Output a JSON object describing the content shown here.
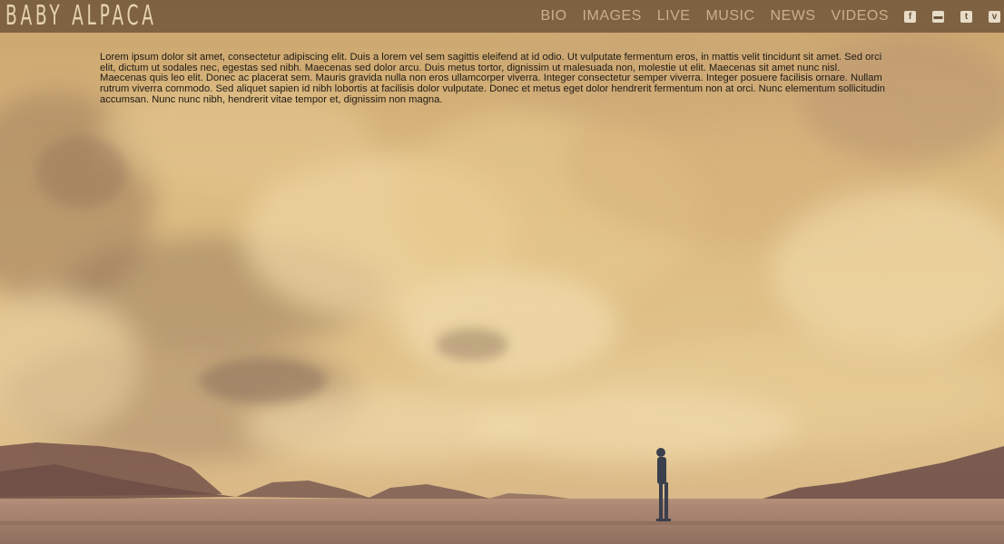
{
  "site": {
    "logo_text": "BABY ALPACA"
  },
  "nav": {
    "items": [
      {
        "label": "BIO"
      },
      {
        "label": "IMAGES"
      },
      {
        "label": "LIVE"
      },
      {
        "label": "MUSIC"
      },
      {
        "label": "NEWS"
      },
      {
        "label": "VIDEOS"
      }
    ]
  },
  "social": {
    "icons": [
      "facebook-icon",
      "soundcloud-icon",
      "twitter-icon",
      "vimeo-icon"
    ],
    "glyphs": [
      "f",
      "▬",
      "t",
      "v"
    ]
  },
  "intro": {
    "text": "Lorem ipsum dolor sit amet, consectetur adipiscing elit. Duis a lorem vel sem sagittis eleifend at id odio. Ut vulputate fermentum eros, in mattis velit tincidunt sit amet. Sed orci elit, dictum ut sodales nec, egestas sed nibh. Maecenas sed dolor arcu. Duis metus tortor, dignissim ut malesuada non, molestie ut elit. Maecenas sit amet nunc nisl. Maecenas quis leo elit. Donec ac placerat sem. Mauris gravida nulla non eros ullamcorper viverra. Integer consectetur semper viverra. Integer posuere facilisis ornare. Nullam rutrum viverra commodo. Sed aliquet sapien id nibh lobortis at facilisis dolor vulputate. Donec et metus eget dolor hendrerit fermentum non at orci. Nunc elementum sollicitudin accumsan. Nunc nunc nibh, hendrerit vitae tempor et, dignissim non magna."
  },
  "colors": {
    "topbar": "#5f4830",
    "nav_text": "#c7b18a",
    "sky": "#d9b57a",
    "ground": "#8a6a5a"
  }
}
